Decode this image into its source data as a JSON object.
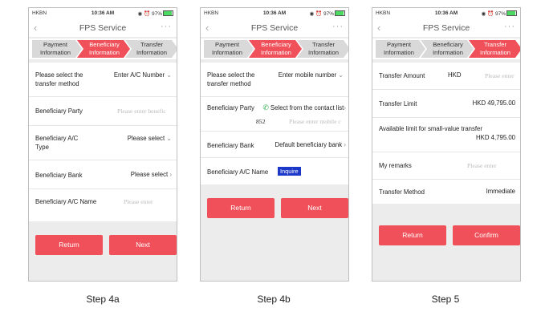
{
  "status": {
    "carrier": "HKBN",
    "time": "10:36 AM",
    "battery": "97%"
  },
  "header": {
    "title": "FPS Service",
    "more": "···",
    "back": "‹"
  },
  "steps": [
    {
      "line1": "Payment",
      "line2": "Information"
    },
    {
      "line1": "Beneficiary",
      "line2": "Information"
    },
    {
      "line1": "Transfer",
      "line2": "Information"
    }
  ],
  "screen_a": {
    "rows": [
      {
        "label": "Please select the transfer method",
        "value": "Enter A/C Number"
      },
      {
        "label": "Beneficiary Party",
        "placeholder": "Please enter benefic"
      },
      {
        "label": "Beneficiary A/C Type",
        "value": "Please select"
      },
      {
        "label": "Beneficiary Bank",
        "value": "Please select"
      },
      {
        "label": "Beneficiary A/C Name",
        "placeholder": "Please enter"
      }
    ],
    "return_label": "Return",
    "next_label": "Next",
    "caption": "Step 4a"
  },
  "screen_b": {
    "rows": [
      {
        "label": "Please select the transfer method",
        "value": "Enter mobile number"
      },
      {
        "label": "Beneficiary Party",
        "value": "Select from the contact list",
        "prefix": "852",
        "placeholder": "Please enter mobile c"
      },
      {
        "label": "Beneficiary Bank",
        "value": "Default beneficiary bank"
      },
      {
        "label": "Beneficiary A/C Name",
        "button": "Inquire"
      }
    ],
    "return_label": "Return",
    "next_label": "Next",
    "caption": "Step 4b"
  },
  "screen_c": {
    "rows": [
      {
        "label": "Transfer Amount",
        "currency": "HKD",
        "placeholder": "Please enter"
      },
      {
        "label": "Transfer Limit",
        "value": "HKD 49,795.00"
      },
      {
        "label": "Available limit for small-value transfer",
        "value": "HKD 4,795.00"
      },
      {
        "label": "My remarks",
        "placeholder": "Please enter"
      },
      {
        "label": "Transfer Method",
        "value": "Immediate"
      }
    ],
    "return_label": "Return",
    "confirm_label": "Confirm",
    "caption": "Step 5"
  },
  "colors": {
    "accent": "#f05059",
    "step_inactive": "#d9d9d9",
    "inquire": "#1c38c8",
    "background": "#ececec"
  }
}
